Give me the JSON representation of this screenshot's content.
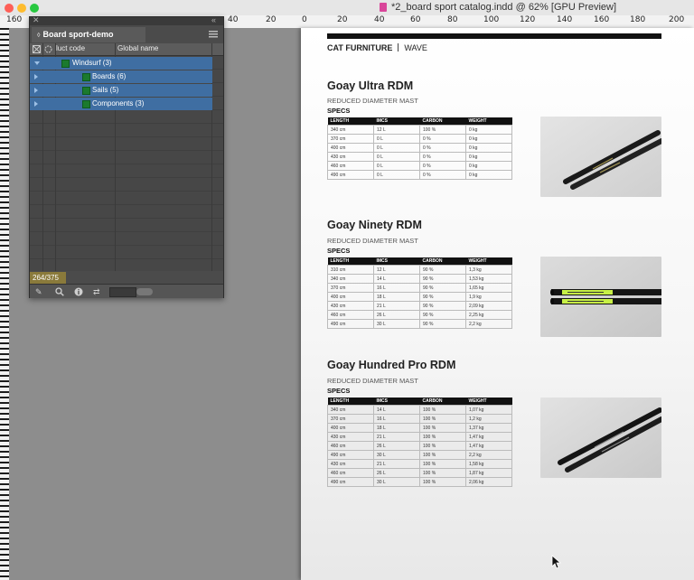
{
  "window": {
    "title": "*2_board sport catalog.indd @ 62% [GPU Preview]"
  },
  "ruler": {
    "h_ticks": [
      "160",
      "40",
      "20",
      "0",
      "20",
      "40",
      "60",
      "80",
      "100",
      "120",
      "140",
      "160",
      "180",
      "200"
    ]
  },
  "panel": {
    "title": "Board sport-demo",
    "col_product_code": "luct code",
    "col_global_name": "Global name",
    "items": [
      {
        "label": "Windsurf (3)"
      },
      {
        "label": "Boards (6)"
      },
      {
        "label": "Sails (5)"
      },
      {
        "label": "Components (3)"
      }
    ],
    "counter": "264/375"
  },
  "page": {
    "header_left": "CAT FURNITURE",
    "header_right": "WAVE",
    "sections": [
      {
        "title": "Goay Ultra RDM",
        "subtitle": "REDUCED DIAMETER MAST",
        "specs_label": "SPECS",
        "headers": [
          "LENGTH",
          "IMCS",
          "CARBON",
          "WEIGHT"
        ],
        "rows": [
          [
            "340 cm",
            "12 L",
            "100 %",
            "0 kg"
          ],
          [
            "370 cm",
            "0 L",
            "0 %",
            "0 kg"
          ],
          [
            "400 cm",
            "0 L",
            "0 %",
            "0 kg"
          ],
          [
            "430 cm",
            "0 L",
            "0 %",
            "0 kg"
          ],
          [
            "460 cm",
            "0 L",
            "0 %",
            "0 kg"
          ],
          [
            "490 cm",
            "0 L",
            "0 %",
            "0 kg"
          ]
        ]
      },
      {
        "title": "Goay Ninety RDM",
        "subtitle": "REDUCED DIAMETER MAST",
        "specs_label": "SPECS",
        "headers": [
          "LENGTH",
          "IMCS",
          "CARBON",
          "WEIGHT"
        ],
        "rows": [
          [
            "310 cm",
            "12 L",
            "90 %",
            "1,3 kg"
          ],
          [
            "340 cm",
            "14 L",
            "90 %",
            "1,53 kg"
          ],
          [
            "370 cm",
            "16 L",
            "90 %",
            "1,65 kg"
          ],
          [
            "400 cm",
            "18 L",
            "90 %",
            "1,9 kg"
          ],
          [
            "430 cm",
            "21 L",
            "90 %",
            "2,09 kg"
          ],
          [
            "460 cm",
            "26 L",
            "90 %",
            "2,25 kg"
          ],
          [
            "490 cm",
            "30 L",
            "90 %",
            "2,2 kg"
          ]
        ]
      },
      {
        "title": "Goay Hundred Pro RDM",
        "subtitle": "REDUCED DIAMETER MAST",
        "specs_label": "SPECS",
        "headers": [
          "LENGTH",
          "IMCS",
          "CARBON",
          "WEIGHT"
        ],
        "rows": [
          [
            "340 cm",
            "14 L",
            "100 %",
            "1,07 kg"
          ],
          [
            "370 cm",
            "16 L",
            "100 %",
            "1,2 kg"
          ],
          [
            "400 cm",
            "18 L",
            "100 %",
            "1,37 kg"
          ],
          [
            "430 cm",
            "21 L",
            "100 %",
            "1,47 kg"
          ],
          [
            "460 cm",
            "26 L",
            "100 %",
            "1,47 kg"
          ],
          [
            "490 cm",
            "30 L",
            "100 %",
            "2,2 kg"
          ],
          [
            "430 cm",
            "21 L",
            "100 %",
            "1,58 kg"
          ],
          [
            "460 cm",
            "26 L",
            "100 %",
            "1,87 kg"
          ],
          [
            "490 cm",
            "30 L",
            "100 %",
            "2,06 kg"
          ]
        ]
      }
    ]
  },
  "colors": {
    "selection": "#3f6ea2",
    "swatch_green": "#1b7a2e",
    "counter_bg": "#8a7a3b",
    "mast_green": "#c7f046"
  }
}
